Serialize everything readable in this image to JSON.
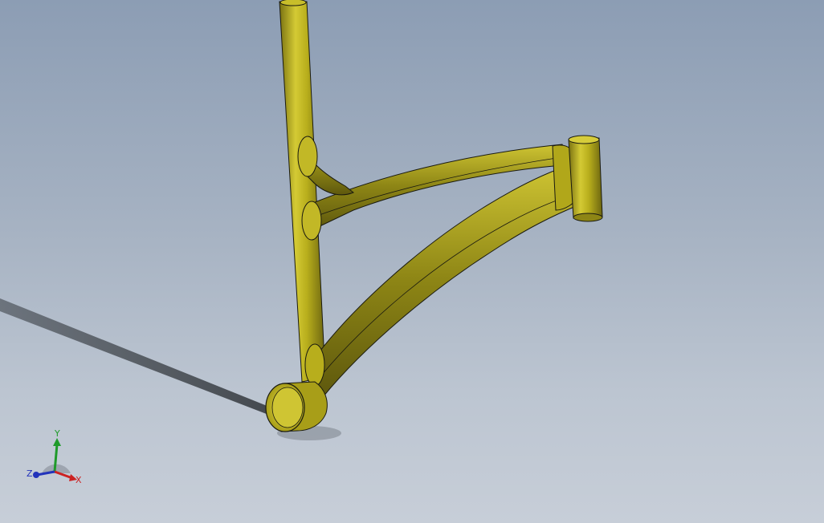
{
  "colors": {
    "part_fill": "#b8ae1c",
    "part_shade": "#6b6410",
    "part_highlight": "#e0d64a",
    "edge": "#1a1a10",
    "shadow": "#1e2226",
    "axis_x": "#cc2222",
    "axis_y": "#1f9a2a",
    "axis_z": "#2233bb"
  },
  "triad": {
    "x_label": "X",
    "y_label": "Y",
    "z_label": "Z"
  }
}
